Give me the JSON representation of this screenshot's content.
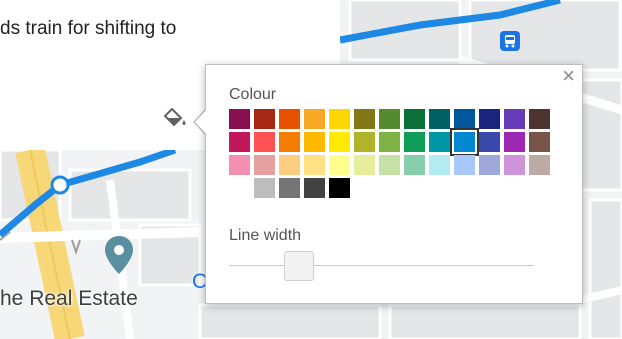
{
  "map": {
    "info_text": "ds train for shifting to",
    "place_label": "he Real Estate",
    "place_label_fragment": "C"
  },
  "popup": {
    "close_label": "×",
    "colour_label": "Colour",
    "line_width_label": "Line width",
    "selected_color": "#0288d1",
    "line_width_value": 0.2,
    "palette": [
      [
        "#880e4f",
        "#a52714",
        "#e65100",
        "#f9a825",
        "#ffd600",
        "#817717",
        "#558b2f",
        "#097138",
        "#006064",
        "#01579b",
        "#1a237e",
        "#673ab7",
        "#4e342e"
      ],
      [
        "#c2185b",
        "#ff5252",
        "#f57c00",
        "#ffba00",
        "#ffea00",
        "#afb42b",
        "#7cb342",
        "#0f9d58",
        "#0097a7",
        "#0288d1",
        "#3949ab",
        "#9c27b0",
        "#795548"
      ],
      [
        "#f48fb1",
        "#e6a0a0",
        "#ffcc80",
        "#ffe082",
        "#ffff8d",
        "#e6ee9c",
        "#c5e1a5",
        "#87ceac",
        "#b2ebf2",
        "#a8c8f9",
        "#9fa8da",
        "#ce93d8",
        "#bcaaa4"
      ],
      [
        "#bdbdbd",
        "#757575",
        "#424242",
        "#000000"
      ]
    ]
  },
  "icons": {
    "paint": "paint-bucket-icon",
    "transit": "bus-icon",
    "pin": "place-pin-icon"
  }
}
